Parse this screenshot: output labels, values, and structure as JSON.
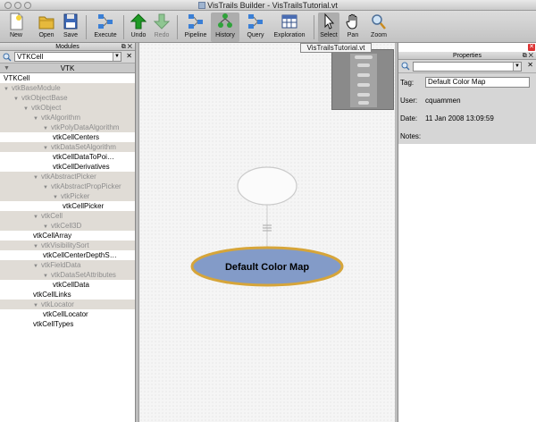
{
  "window": {
    "title": "VisTrails Builder - VisTrailsTutorial.vt"
  },
  "toolbar": {
    "new": "New",
    "open": "Open",
    "save": "Save",
    "execute": "Execute",
    "undo": "Undo",
    "redo": "Redo",
    "pipeline": "Pipeline",
    "history": "History",
    "query": "Query",
    "exploration": "Exploration",
    "select": "Select",
    "pan": "Pan",
    "zoom": "Zoom"
  },
  "modules_panel": {
    "title": "Modules",
    "search_value": "VTKCell",
    "tree_header": "VTK",
    "rows": [
      {
        "label": "VTKCell",
        "depth": 0,
        "kind": "leaf"
      },
      {
        "label": "vtkBaseModule",
        "depth": 0,
        "kind": "cat"
      },
      {
        "label": "vtkObjectBase",
        "depth": 1,
        "kind": "cat"
      },
      {
        "label": "vtkObject",
        "depth": 2,
        "kind": "cat"
      },
      {
        "label": "vtkAlgorithm",
        "depth": 3,
        "kind": "cat"
      },
      {
        "label": "vtkPolyDataAlgorithm",
        "depth": 4,
        "kind": "cat"
      },
      {
        "label": "vtkCellCenters",
        "depth": 5,
        "kind": "leaf"
      },
      {
        "label": "vtkDataSetAlgorithm",
        "depth": 4,
        "kind": "cat"
      },
      {
        "label": "vtkCellDataToPoi…",
        "depth": 5,
        "kind": "leaf"
      },
      {
        "label": "vtkCellDerivatives",
        "depth": 5,
        "kind": "leaf"
      },
      {
        "label": "vtkAbstractPicker",
        "depth": 3,
        "kind": "cat"
      },
      {
        "label": "vtkAbstractPropPicker",
        "depth": 4,
        "kind": "cat"
      },
      {
        "label": "vtkPicker",
        "depth": 5,
        "kind": "cat"
      },
      {
        "label": "vtkCellPicker",
        "depth": 6,
        "kind": "leaf"
      },
      {
        "label": "vtkCell",
        "depth": 3,
        "kind": "cat"
      },
      {
        "label": "vtkCell3D",
        "depth": 4,
        "kind": "cat"
      },
      {
        "label": "vtkCellArray",
        "depth": 3,
        "kind": "leaf"
      },
      {
        "label": "vtkVisibilitySort",
        "depth": 3,
        "kind": "cat"
      },
      {
        "label": "vtkCellCenterDepthS…",
        "depth": 4,
        "kind": "leaf"
      },
      {
        "label": "vtkFieldData",
        "depth": 3,
        "kind": "cat"
      },
      {
        "label": "vtkDataSetAttributes",
        "depth": 4,
        "kind": "cat"
      },
      {
        "label": "vtkCellData",
        "depth": 5,
        "kind": "leaf"
      },
      {
        "label": "vtkCellLinks",
        "depth": 3,
        "kind": "leaf"
      },
      {
        "label": "vtkLocator",
        "depth": 3,
        "kind": "cat"
      },
      {
        "label": "vtkCellLocator",
        "depth": 4,
        "kind": "leaf"
      },
      {
        "label": "vtkCellTypes",
        "depth": 3,
        "kind": "leaf"
      }
    ]
  },
  "canvas": {
    "tab_label": "VisTrailsTutorial.vt",
    "node_label": "Default Color Map"
  },
  "properties_panel": {
    "title": "Properties",
    "tag_label": "Tag:",
    "tag_value": "Default Color Map",
    "user_label": "User:",
    "user_value": "cquammen",
    "date_label": "Date:",
    "date_value": "11 Jan 2008 13:09:59",
    "notes_label": "Notes:"
  }
}
